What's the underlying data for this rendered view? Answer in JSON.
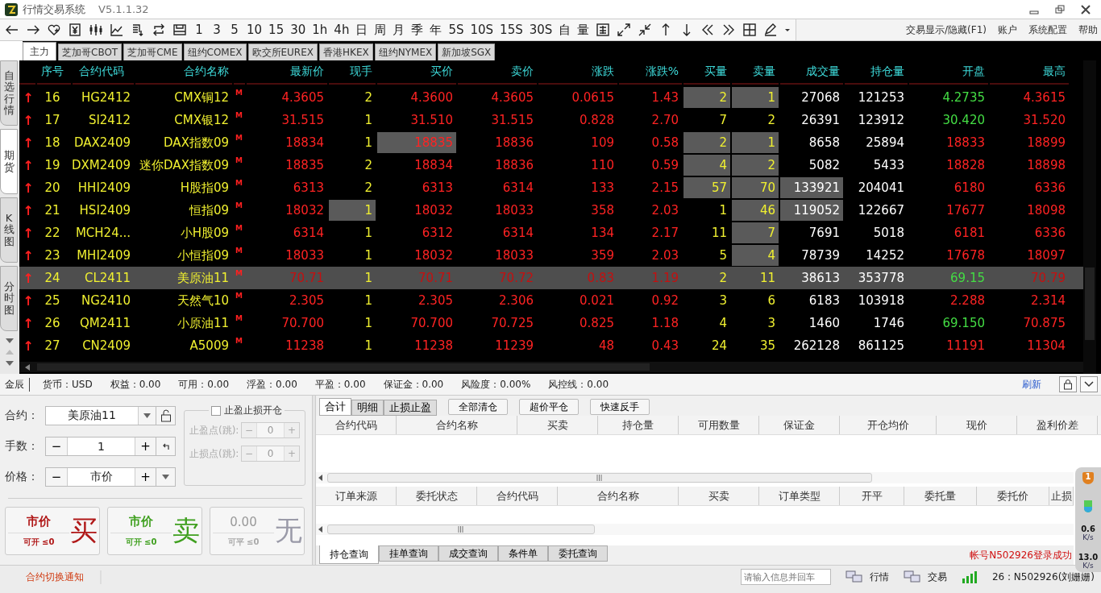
{
  "window": {
    "title": "行情交易系统",
    "version": "V5.1.1.32"
  },
  "toolbar": {
    "periods": [
      "1",
      "3",
      "5",
      "10",
      "15",
      "30",
      "1h",
      "4h",
      "日",
      "周",
      "月",
      "季",
      "年",
      "5S",
      "10S",
      "15S",
      "30S",
      "自",
      "量"
    ],
    "menu": [
      "交易显示/隐藏(F1)",
      "账户",
      "系统配置",
      "帮助"
    ]
  },
  "market_tabs": [
    {
      "label": "主力",
      "selected": true
    },
    {
      "label": "芝加哥CBOT",
      "selected": false
    },
    {
      "label": "芝加哥CME",
      "selected": false
    },
    {
      "label": "纽约COMEX",
      "selected": false
    },
    {
      "label": "欧交所EUREX",
      "selected": false
    },
    {
      "label": "香港HKEX",
      "selected": false
    },
    {
      "label": "纽约NYMEX",
      "selected": false
    },
    {
      "label": "新加坡SGX",
      "selected": false
    }
  ],
  "side_tabs": [
    {
      "label": "自选行情",
      "selected": false
    },
    {
      "label": "期货",
      "selected": true
    },
    {
      "label": "K线图",
      "selected": false
    },
    {
      "label": "分时图",
      "selected": false
    }
  ],
  "quote_table": {
    "columns": [
      {
        "label": "序号",
        "kind": "symbol"
      },
      {
        "label": "合约代码",
        "kind": "symbol"
      },
      {
        "label": "合约名称",
        "kind": "symbol"
      },
      {
        "label": "最新价",
        "kind": "price"
      },
      {
        "label": "现手",
        "kind": "count"
      },
      {
        "label": "买价",
        "kind": "price"
      },
      {
        "label": "卖价",
        "kind": "price"
      },
      {
        "label": "涨跌",
        "kind": "price"
      },
      {
        "label": "涨跌%",
        "kind": "price"
      },
      {
        "label": "买量",
        "kind": "count"
      },
      {
        "label": "卖量",
        "kind": "count"
      },
      {
        "label": "成交量",
        "kind": "volume"
      },
      {
        "label": "持仓量",
        "kind": "volume"
      },
      {
        "label": "开盘",
        "kind": "trend"
      },
      {
        "label": "最高",
        "kind": "price"
      }
    ],
    "rows": [
      {
        "selected": false,
        "arrow": "↑",
        "mark": "M",
        "open_down": true,
        "cells": [
          "16",
          "HG2412",
          "CMX铜12",
          "4.3605",
          "2",
          "4.3600",
          "4.3605",
          "0.0615",
          "1.43",
          "2",
          "1",
          "27068",
          "121253",
          "4.2735",
          "4.3615"
        ],
        "flashed": [
          false,
          false,
          false,
          false,
          false,
          false,
          false,
          false,
          false,
          true,
          true,
          false,
          false,
          false,
          false
        ]
      },
      {
        "selected": false,
        "arrow": "↑",
        "mark": "M",
        "open_down": true,
        "cells": [
          "17",
          "SI2412",
          "CMX银12",
          "31.515",
          "1",
          "31.510",
          "31.515",
          "0.828",
          "2.70",
          "7",
          "2",
          "26391",
          "123912",
          "30.420",
          "31.520"
        ],
        "flashed": [
          false,
          false,
          false,
          false,
          false,
          false,
          false,
          false,
          false,
          false,
          false,
          false,
          false,
          false,
          false
        ]
      },
      {
        "selected": false,
        "arrow": "↑",
        "mark": "M",
        "open_down": false,
        "cells": [
          "18",
          "DAX2409",
          "DAX指数09",
          "18834",
          "1",
          "18835",
          "18836",
          "109",
          "0.58",
          "2",
          "1",
          "8658",
          "25894",
          "18833",
          "18899"
        ],
        "flashed": [
          false,
          false,
          false,
          false,
          false,
          true,
          false,
          false,
          false,
          true,
          true,
          false,
          false,
          false,
          false
        ]
      },
      {
        "selected": false,
        "arrow": "↑",
        "mark": "M",
        "open_down": false,
        "cells": [
          "19",
          "DXM2409",
          "迷你DAX指数09",
          "18835",
          "2",
          "18834",
          "18836",
          "110",
          "0.59",
          "4",
          "2",
          "5082",
          "5433",
          "18828",
          "18898"
        ],
        "flashed": [
          false,
          false,
          false,
          false,
          false,
          false,
          false,
          false,
          false,
          true,
          true,
          false,
          false,
          false,
          false
        ]
      },
      {
        "selected": false,
        "arrow": "↑",
        "mark": "M",
        "open_down": false,
        "cells": [
          "20",
          "HHI2409",
          "H股指09",
          "6313",
          "2",
          "6313",
          "6314",
          "133",
          "2.15",
          "57",
          "70",
          "133921",
          "204041",
          "6180",
          "6336"
        ],
        "flashed": [
          false,
          false,
          false,
          false,
          false,
          false,
          false,
          false,
          false,
          true,
          true,
          true,
          false,
          false,
          false
        ]
      },
      {
        "selected": false,
        "arrow": "↑",
        "mark": "M",
        "open_down": false,
        "cells": [
          "21",
          "HSI2409",
          "恒指09",
          "18032",
          "1",
          "18032",
          "18033",
          "358",
          "2.03",
          "1",
          "46",
          "119052",
          "122667",
          "17677",
          "18098"
        ],
        "flashed": [
          false,
          false,
          false,
          false,
          true,
          false,
          false,
          false,
          false,
          false,
          true,
          true,
          false,
          false,
          false
        ]
      },
      {
        "selected": false,
        "arrow": "↑",
        "mark": "M",
        "open_down": false,
        "cells": [
          "22",
          "MCH24...",
          "小H股09",
          "6314",
          "1",
          "6312",
          "6314",
          "134",
          "2.17",
          "11",
          "7",
          "7691",
          "5018",
          "6181",
          "6336"
        ],
        "flashed": [
          false,
          false,
          false,
          false,
          false,
          false,
          false,
          false,
          false,
          false,
          true,
          false,
          false,
          false,
          false
        ]
      },
      {
        "selected": false,
        "arrow": "↑",
        "mark": "M",
        "open_down": false,
        "cells": [
          "23",
          "MHI2409",
          "小恒指09",
          "18033",
          "1",
          "18032",
          "18033",
          "359",
          "2.03",
          "5",
          "4",
          "78739",
          "14252",
          "17678",
          "18097"
        ],
        "flashed": [
          false,
          false,
          false,
          false,
          false,
          false,
          false,
          false,
          false,
          false,
          true,
          false,
          false,
          false,
          false
        ]
      },
      {
        "selected": true,
        "arrow": "↑",
        "mark": "M",
        "open_down": true,
        "cells": [
          "24",
          "CL2411",
          "美原油11",
          "70.71",
          "1",
          "70.71",
          "70.72",
          "0.83",
          "1.19",
          "2",
          "11",
          "38613",
          "353778",
          "69.15",
          "70.79"
        ],
        "flashed": [
          false,
          false,
          false,
          false,
          false,
          false,
          false,
          false,
          false,
          false,
          false,
          false,
          false,
          false,
          false
        ]
      },
      {
        "selected": false,
        "arrow": "↑",
        "mark": "M",
        "open_down": false,
        "cells": [
          "25",
          "NG2410",
          "天然气10",
          "2.305",
          "1",
          "2.305",
          "2.306",
          "0.021",
          "0.92",
          "3",
          "6",
          "6183",
          "103918",
          "2.288",
          "2.314"
        ],
        "flashed": [
          false,
          false,
          false,
          false,
          false,
          false,
          false,
          false,
          false,
          false,
          false,
          false,
          false,
          false,
          false
        ]
      },
      {
        "selected": false,
        "arrow": "↑",
        "mark": "M",
        "open_down": true,
        "cells": [
          "26",
          "QM2411",
          "小原油11",
          "70.700",
          "1",
          "70.700",
          "70.725",
          "0.825",
          "1.18",
          "4",
          "3",
          "1460",
          "1746",
          "69.150",
          "70.875"
        ],
        "flashed": [
          false,
          false,
          false,
          false,
          false,
          false,
          false,
          false,
          false,
          false,
          false,
          false,
          false,
          false,
          false
        ]
      },
      {
        "selected": false,
        "arrow": "↑",
        "mark": "M",
        "open_down": false,
        "cells": [
          "27",
          "CN2409",
          "A5009",
          "11238",
          "1",
          "11238",
          "11239",
          "48",
          "0.43",
          "24",
          "35",
          "262128",
          "861125",
          "11191",
          "11304"
        ],
        "flashed": [
          false,
          false,
          false,
          false,
          false,
          false,
          false,
          false,
          false,
          false,
          false,
          false,
          false,
          false,
          false
        ]
      }
    ]
  },
  "account_bar": {
    "name": "金辰",
    "fields": [
      {
        "label": "货币：",
        "value": "USD"
      },
      {
        "label": "权益：",
        "value": "0.00"
      },
      {
        "label": "可用：",
        "value": "0.00"
      },
      {
        "label": "浮盈：",
        "value": "0.00"
      },
      {
        "label": "平盈：",
        "value": "0.00"
      },
      {
        "label": "保证金：",
        "value": "0.00"
      },
      {
        "label": "风险度：",
        "value": "0.00%"
      },
      {
        "label": "风控线：",
        "value": "0.00"
      }
    ],
    "refresh": "刷新"
  },
  "order_panel": {
    "contract": {
      "label": "合约：",
      "value": "美原油11"
    },
    "lots": {
      "label": "手数：",
      "minus": "−",
      "value": "1",
      "plus": "+"
    },
    "price": {
      "label": "价格：",
      "minus": "−",
      "value": "市价",
      "plus": "+"
    },
    "stop_group": {
      "title": "止盈止损开仓",
      "checked": false,
      "fields": [
        {
          "label": "止盈点(跳):",
          "minus": "−",
          "value": "0",
          "plus": "+",
          "disabled": true
        },
        {
          "label": "止损点(跳):",
          "minus": "−",
          "value": "0",
          "plus": "+",
          "disabled": true
        }
      ]
    },
    "trade_buttons": [
      {
        "kind": "buy",
        "price": "市价",
        "limit": "可开 ≤0",
        "side": "买",
        "disabled": false
      },
      {
        "kind": "sell",
        "price": "市价",
        "limit": "可开 ≤0",
        "side": "卖",
        "disabled": false
      },
      {
        "kind": "none",
        "price": "0.00",
        "limit": "可平 ≤0",
        "side": "无",
        "disabled": true
      }
    ]
  },
  "positions": {
    "tabs": [
      {
        "label": "合计",
        "selected": true
      },
      {
        "label": "明细",
        "selected": false
      },
      {
        "label": "止损止盈",
        "selected": false
      }
    ],
    "actions": [
      "全部清仓",
      "超价平仓",
      "快速反手"
    ],
    "columns": [
      "合约代码",
      "合约名称",
      "买卖",
      "持仓量",
      "可用数量",
      "保证金",
      "开仓均价",
      "现价",
      "盈利价差"
    ],
    "order_columns": [
      "订单来源",
      "委托状态",
      "合约代码",
      "合约名称",
      "买卖",
      "订单类型",
      "开平",
      "委托量",
      "委托价",
      "止损"
    ],
    "query_tabs": [
      {
        "label": "持仓查询",
        "selected": true
      },
      {
        "label": "挂单查询",
        "selected": false
      },
      {
        "label": "成交查询",
        "selected": false
      },
      {
        "label": "条件单",
        "selected": false
      },
      {
        "label": "委托查询",
        "selected": false
      }
    ],
    "message": "帐号N502926登录成功"
  },
  "status_bar": {
    "notice": "合约切换通知",
    "search": {
      "placeholder": "请输入信息并回车"
    },
    "links": [
      "行情",
      "交易"
    ],
    "account": "26 : N502926(刘姗姗)"
  },
  "speed_widget": {
    "badge": "1",
    "up": "0.6",
    "up_unit": "K/s",
    "down": "13.0",
    "down_unit": "K/s"
  }
}
